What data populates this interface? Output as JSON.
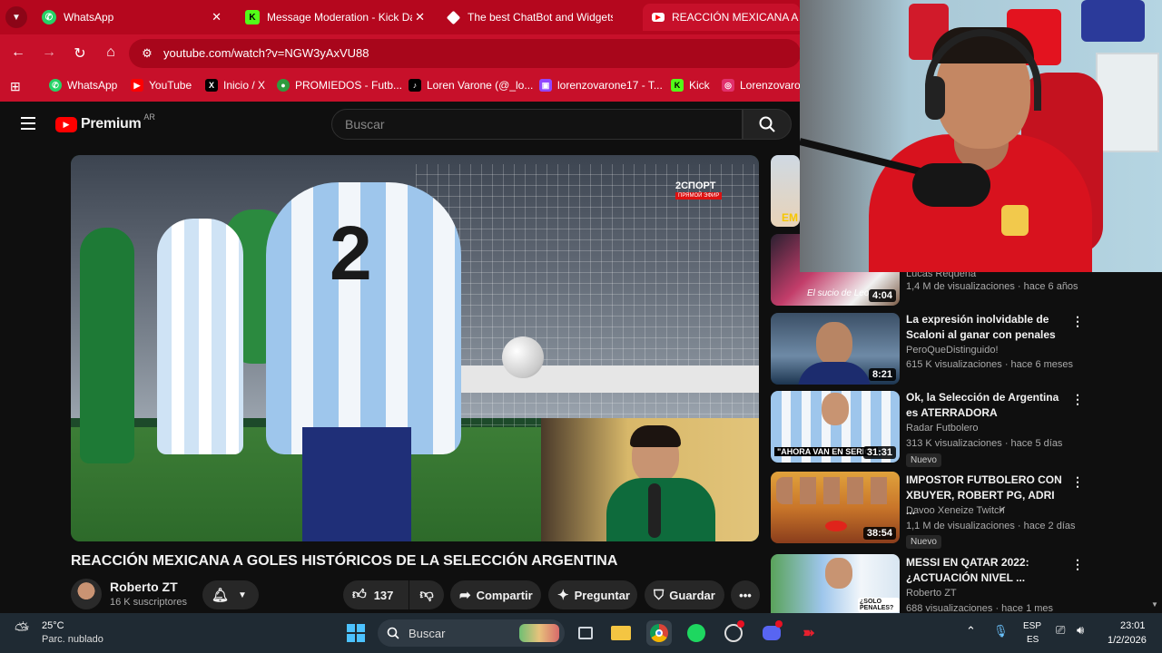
{
  "tabs": [
    {
      "label": "WhatsApp",
      "color": "#25d366"
    },
    {
      "label": "Message Moderation - Kick Da",
      "color": "#53fc18"
    },
    {
      "label": "The best ChatBot and Widgets",
      "color": "#ffffff"
    },
    {
      "label": "REACCIÓN MEXICANA A GO",
      "color": "#ff0000"
    }
  ],
  "address": {
    "url": "youtube.com/watch?v=NGW3yAxVU88"
  },
  "bookmarks": [
    {
      "label": "WhatsApp",
      "color": "#25d366"
    },
    {
      "label": "YouTube",
      "color": "#ff0000"
    },
    {
      "label": "Inicio / X",
      "color": "#000000"
    },
    {
      "label": "PROMIEDOS - Futb...",
      "color": "#2e9b3e"
    },
    {
      "label": "Loren Varone (@_lo...",
      "color": "#000000"
    },
    {
      "label": "lorenzovarone17 - T...",
      "color": "#9146ff"
    },
    {
      "label": "Kick",
      "color": "#53fc18"
    },
    {
      "label": "Lorenzovaron",
      "color": "#e1306c"
    }
  ],
  "youtube": {
    "logo": "Premium",
    "region": "AR",
    "search_placeholder": "Buscar"
  },
  "video": {
    "overlay_logo": "2СПОРТ",
    "overlay_sub": "ПРЯМОЙ ЭФИР",
    "player_number": "2",
    "title": "REACCIÓN MEXICANA A GOLES HISTÓRICOS DE LA SELECCIÓN ARGENTINA"
  },
  "channel": {
    "name": "Roberto ZT",
    "subscribers": "16 K suscriptores"
  },
  "actions": {
    "likes": "137",
    "share": "Compartir",
    "ask": "Preguntar",
    "save": "Guardar"
  },
  "sidebar": [
    {
      "thumb_text": "EM",
      "duration": "",
      "title": "",
      "channel": "",
      "meta": "",
      "badge": ""
    },
    {
      "thumb_text": "El sucio de Leo",
      "duration": "4:04",
      "title": "",
      "channel": "Lucas Requena",
      "meta": "1,4 M de visualizaciones · hace 6 años",
      "badge": ""
    },
    {
      "thumb_text": "",
      "duration": "8:21",
      "title": "La expresión inolvidable de Scaloni al ganar con penales",
      "channel": "PeroQueDistinguido!",
      "meta": "615 K visualizaciones · hace 6 meses",
      "badge": ""
    },
    {
      "thumb_text": "\"AHORA VAN EN SERIO\"",
      "duration": "31:31",
      "title": "Ok, la Selección de Argentina es ATERRADORA",
      "channel": "Radar Futbolero",
      "meta": "313 K visualizaciones · hace 5 días",
      "badge": "Nuevo"
    },
    {
      "thumb_text": "",
      "duration": "38:54",
      "title": "IMPOSTOR FUTBOLERO CON XBUYER, ROBERT PG, ADRI ...",
      "channel": "Davoo Xeneize Twitch",
      "meta": "1,1 M de visualizaciones · hace 2 días",
      "badge": "Nuevo"
    },
    {
      "thumb_text": "¿SOLO PENALES?",
      "duration": "",
      "title": "MESSI EN QATAR 2022: ¿ACTUACIÓN NIVEL ...",
      "channel": "Roberto ZT",
      "meta": "688 visualizaciones · hace 1 mes",
      "badge": ""
    }
  ],
  "taskbar": {
    "weather_temp": "25°C",
    "weather_desc": "Parc. nublado",
    "search": "Buscar",
    "lang_top": "ESP",
    "lang_bottom": "ES",
    "time": "23:01",
    "date": "1/2/2026"
  }
}
